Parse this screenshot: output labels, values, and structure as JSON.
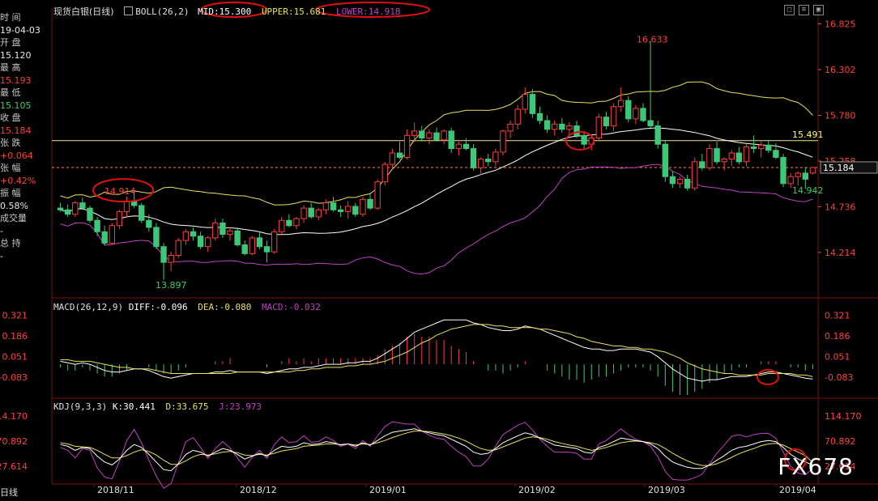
{
  "header": {
    "instrument": "现货白银",
    "period": "(日线)",
    "boll_label": "BOLL(26,2)",
    "mid": "MID:15.300",
    "upper": "UPPER:15.681",
    "lower": "LOWER:14.918"
  },
  "sidebar": [
    {
      "label": "时 间",
      "value": "19-04-03",
      "color": "normal"
    },
    {
      "label": "开 盘",
      "value": "15.120",
      "color": "normal"
    },
    {
      "label": "最 高",
      "value": "15.193",
      "color": "red"
    },
    {
      "label": "最 低",
      "value": "15.105",
      "color": "green"
    },
    {
      "label": "收 盘",
      "value": "15.184",
      "color": "red"
    },
    {
      "label": "张 跌",
      "value": "+0.064",
      "color": "red"
    },
    {
      "label": "张 幅",
      "value": "+0.42%",
      "color": "red"
    },
    {
      "label": "振 幅",
      "value": "0.58%",
      "color": "normal"
    },
    {
      "label": "成交量",
      "value": "-",
      "color": "normal"
    },
    {
      "label": "总 持",
      "value": "-",
      "color": "normal"
    }
  ],
  "macd_header": {
    "label": "MACD(26,12,9)",
    "diff": "DIFF:-0.096",
    "dea": "DEA:-0.080",
    "macd": "MACD:-0.032"
  },
  "kdj_header": {
    "label": "KDJ(9,3,3)",
    "k": "K:30.441",
    "d": "D:33.675",
    "j": "J:23.973"
  },
  "bottom_tab": "日线",
  "watermark": "FX678",
  "colors": {
    "up": "#ff3c3c",
    "down": "#3cc878",
    "mid": "#ffffff",
    "upper": "#e8e060",
    "lower": "#c040c0",
    "hline": "#f0e68c",
    "dashed": "#ff8c3c"
  },
  "chart_data": [
    {
      "type": "candlestick",
      "title": "现货白银(日线)",
      "x_tick_labels": [
        "2018/11",
        "2018/12",
        "2019/01",
        "2019/02",
        "2019/03",
        "2019/04"
      ],
      "y_ticks": [
        16.825,
        16.302,
        15.78,
        15.258,
        14.736,
        14.214
      ],
      "ylim": [
        13.75,
        16.95
      ],
      "horizontal_line": 15.491,
      "current_price": 15.184,
      "annotations": [
        {
          "text": "16.633",
          "value": 16.633
        },
        {
          "text": "15.491",
          "value": 15.491
        },
        {
          "text": "14.914",
          "value": 14.914
        },
        {
          "text": "14.942",
          "value": 14.942
        },
        {
          "text": "13.897",
          "value": 13.897
        }
      ],
      "candles": [
        [
          14.72,
          14.78,
          14.68,
          14.7
        ],
        [
          14.7,
          14.76,
          14.62,
          14.65
        ],
        [
          14.65,
          14.8,
          14.62,
          14.78
        ],
        [
          14.78,
          14.84,
          14.7,
          14.72
        ],
        [
          14.72,
          14.75,
          14.55,
          14.58
        ],
        [
          14.58,
          14.62,
          14.4,
          14.45
        ],
        [
          14.45,
          14.52,
          14.3,
          14.32
        ],
        [
          14.32,
          14.55,
          14.3,
          14.52
        ],
        [
          14.52,
          14.7,
          14.48,
          14.68
        ],
        [
          14.68,
          14.85,
          14.62,
          14.8
        ],
        [
          14.8,
          14.9,
          14.72,
          14.75
        ],
        [
          14.75,
          14.78,
          14.55,
          14.58
        ],
        [
          14.58,
          14.65,
          14.45,
          14.5
        ],
        [
          14.5,
          14.55,
          14.25,
          14.28
        ],
        [
          14.28,
          14.32,
          13.9,
          14.1
        ],
        [
          14.1,
          14.22,
          14.0,
          14.18
        ],
        [
          14.18,
          14.38,
          14.15,
          14.35
        ],
        [
          14.35,
          14.48,
          14.3,
          14.45
        ],
        [
          14.45,
          14.5,
          14.35,
          14.4
        ],
        [
          14.4,
          14.45,
          14.25,
          14.28
        ],
        [
          14.28,
          14.4,
          14.22,
          14.38
        ],
        [
          14.38,
          14.6,
          14.35,
          14.55
        ],
        [
          14.55,
          14.6,
          14.38,
          14.42
        ],
        [
          14.42,
          14.5,
          14.35,
          14.46
        ],
        [
          14.46,
          14.5,
          14.28,
          14.3
        ],
        [
          14.3,
          14.35,
          14.18,
          14.2
        ],
        [
          14.2,
          14.4,
          14.18,
          14.38
        ],
        [
          14.38,
          14.45,
          14.25,
          14.28
        ],
        [
          14.28,
          14.35,
          14.1,
          14.22
        ],
        [
          14.22,
          14.48,
          14.2,
          14.45
        ],
        [
          14.45,
          14.62,
          14.42,
          14.58
        ],
        [
          14.58,
          14.65,
          14.5,
          14.52
        ],
        [
          14.52,
          14.62,
          14.48,
          14.6
        ],
        [
          14.6,
          14.75,
          14.55,
          14.72
        ],
        [
          14.72,
          14.78,
          14.6,
          14.62
        ],
        [
          14.62,
          14.72,
          14.58,
          14.7
        ],
        [
          14.7,
          14.82,
          14.65,
          14.78
        ],
        [
          14.78,
          14.85,
          14.68,
          14.7
        ],
        [
          14.7,
          14.75,
          14.62,
          14.68
        ],
        [
          14.68,
          14.8,
          14.6,
          14.74
        ],
        [
          14.74,
          14.78,
          14.62,
          14.65
        ],
        [
          14.65,
          14.85,
          14.62,
          14.82
        ],
        [
          14.82,
          14.88,
          14.7,
          14.72
        ],
        [
          14.72,
          15.05,
          14.7,
          15.02
        ],
        [
          15.02,
          15.25,
          14.98,
          15.22
        ],
        [
          15.22,
          15.4,
          15.18,
          15.35
        ],
        [
          15.35,
          15.48,
          15.28,
          15.3
        ],
        [
          15.3,
          15.62,
          15.28,
          15.55
        ],
        [
          15.55,
          15.7,
          15.48,
          15.6
        ],
        [
          15.6,
          15.66,
          15.48,
          15.52
        ],
        [
          15.52,
          15.62,
          15.45,
          15.58
        ],
        [
          15.58,
          15.64,
          15.48,
          15.5
        ],
        [
          15.5,
          15.62,
          15.45,
          15.6
        ],
        [
          15.6,
          15.64,
          15.35,
          15.4
        ],
        [
          15.4,
          15.48,
          15.32,
          15.45
        ],
        [
          15.45,
          15.52,
          15.38,
          15.4
        ],
        [
          15.4,
          15.45,
          15.15,
          15.18
        ],
        [
          15.18,
          15.3,
          15.1,
          15.28
        ],
        [
          15.28,
          15.34,
          15.2,
          15.25
        ],
        [
          15.25,
          15.4,
          15.2,
          15.36
        ],
        [
          15.36,
          15.62,
          15.32,
          15.6
        ],
        [
          15.6,
          15.72,
          15.52,
          15.68
        ],
        [
          15.68,
          15.9,
          15.62,
          15.85
        ],
        [
          15.85,
          16.1,
          15.8,
          16.02
        ],
        [
          16.02,
          16.08,
          15.75,
          15.8
        ],
        [
          15.8,
          15.88,
          15.68,
          15.72
        ],
        [
          15.72,
          15.78,
          15.58,
          15.62
        ],
        [
          15.62,
          15.72,
          15.55,
          15.68
        ],
        [
          15.68,
          15.75,
          15.58,
          15.62
        ],
        [
          15.62,
          15.7,
          15.55,
          15.66
        ],
        [
          15.66,
          15.72,
          15.52,
          15.55
        ],
        [
          15.55,
          15.6,
          15.4,
          15.45
        ],
        [
          15.45,
          15.55,
          15.38,
          15.52
        ],
        [
          15.52,
          15.8,
          15.48,
          15.76
        ],
        [
          15.76,
          15.82,
          15.62,
          15.66
        ],
        [
          15.66,
          15.92,
          15.6,
          15.88
        ],
        [
          15.88,
          16.1,
          15.82,
          15.95
        ],
        [
          15.95,
          16.0,
          15.7,
          15.74
        ],
        [
          15.74,
          15.9,
          15.68,
          15.86
        ],
        [
          15.86,
          15.92,
          15.7,
          15.72
        ],
        [
          15.72,
          16.63,
          15.62,
          15.66
        ],
        [
          15.66,
          15.72,
          15.4,
          15.45
        ],
        [
          15.45,
          15.5,
          15.02,
          15.08
        ],
        [
          15.08,
          15.14,
          14.95,
          15.0
        ],
        [
          15.0,
          15.08,
          14.95,
          15.05
        ],
        [
          15.05,
          15.1,
          14.92,
          14.95
        ],
        [
          14.95,
          15.3,
          14.92,
          15.25
        ],
        [
          15.25,
          15.34,
          15.15,
          15.18
        ],
        [
          15.18,
          15.45,
          15.15,
          15.4
        ],
        [
          15.4,
          15.48,
          15.22,
          15.25
        ],
        [
          15.25,
          15.3,
          15.15,
          15.28
        ],
        [
          15.28,
          15.38,
          15.2,
          15.35
        ],
        [
          15.35,
          15.42,
          15.22,
          15.25
        ],
        [
          15.25,
          15.45,
          15.2,
          15.42
        ],
        [
          15.42,
          15.55,
          15.35,
          15.4
        ],
        [
          15.4,
          15.48,
          15.3,
          15.44
        ],
        [
          15.44,
          15.5,
          15.35,
          15.38
        ],
        [
          15.38,
          15.46,
          15.28,
          15.3
        ],
        [
          15.3,
          15.34,
          14.96,
          15.0
        ],
        [
          15.0,
          15.12,
          14.95,
          15.08
        ],
        [
          15.08,
          15.14,
          14.98,
          15.12
        ],
        [
          15.12,
          15.19,
          14.94,
          15.05
        ],
        [
          15.12,
          15.193,
          15.105,
          15.184
        ]
      ]
    },
    {
      "type": "macd",
      "title": "MACD(26,12,9)",
      "y_ticks": [
        0.321,
        0.186,
        0.051,
        -0.083
      ],
      "ylim": [
        -0.2,
        0.36
      ],
      "diff": [
        0.02,
        0.01,
        0.0,
        0.01,
        0.0,
        -0.02,
        -0.04,
        -0.05,
        -0.05,
        -0.04,
        -0.03,
        -0.03,
        -0.04,
        -0.06,
        -0.08,
        -0.09,
        -0.08,
        -0.07,
        -0.06,
        -0.06,
        -0.06,
        -0.05,
        -0.05,
        -0.04,
        -0.05,
        -0.05,
        -0.05,
        -0.05,
        -0.06,
        -0.05,
        -0.04,
        -0.03,
        -0.03,
        -0.02,
        -0.02,
        -0.01,
        0.0,
        0.0,
        0.0,
        0.01,
        0.01,
        0.02,
        0.02,
        0.04,
        0.07,
        0.1,
        0.13,
        0.17,
        0.21,
        0.23,
        0.25,
        0.27,
        0.29,
        0.29,
        0.29,
        0.29,
        0.27,
        0.26,
        0.24,
        0.23,
        0.22,
        0.22,
        0.23,
        0.25,
        0.24,
        0.23,
        0.21,
        0.19,
        0.17,
        0.15,
        0.13,
        0.11,
        0.1,
        0.1,
        0.09,
        0.09,
        0.1,
        0.1,
        0.1,
        0.09,
        0.08,
        0.05,
        0.01,
        -0.03,
        -0.06,
        -0.09,
        -0.1,
        -0.11,
        -0.1,
        -0.1,
        -0.09,
        -0.08,
        -0.08,
        -0.08,
        -0.07,
        -0.06,
        -0.05,
        -0.05,
        -0.06,
        -0.07,
        -0.08,
        -0.09,
        -0.096
      ],
      "dea": [
        0.03,
        0.03,
        0.02,
        0.02,
        0.02,
        0.01,
        0.0,
        -0.01,
        -0.02,
        -0.02,
        -0.03,
        -0.03,
        -0.03,
        -0.04,
        -0.05,
        -0.06,
        -0.06,
        -0.06,
        -0.06,
        -0.06,
        -0.06,
        -0.06,
        -0.06,
        -0.06,
        -0.05,
        -0.05,
        -0.05,
        -0.05,
        -0.05,
        -0.05,
        -0.05,
        -0.05,
        -0.04,
        -0.04,
        -0.03,
        -0.03,
        -0.02,
        -0.02,
        -0.02,
        -0.01,
        -0.01,
        0.0,
        0.0,
        0.01,
        0.02,
        0.04,
        0.06,
        0.08,
        0.11,
        0.14,
        0.16,
        0.19,
        0.21,
        0.23,
        0.24,
        0.25,
        0.26,
        0.26,
        0.26,
        0.25,
        0.25,
        0.24,
        0.24,
        0.24,
        0.24,
        0.23,
        0.23,
        0.22,
        0.21,
        0.2,
        0.18,
        0.17,
        0.15,
        0.14,
        0.13,
        0.12,
        0.12,
        0.11,
        0.11,
        0.1,
        0.1,
        0.09,
        0.08,
        0.06,
        0.04,
        0.01,
        -0.01,
        -0.03,
        -0.04,
        -0.05,
        -0.06,
        -0.06,
        -0.07,
        -0.07,
        -0.07,
        -0.07,
        -0.06,
        -0.06,
        -0.06,
        -0.06,
        -0.07,
        -0.07,
        -0.08
      ]
    },
    {
      "type": "kdj",
      "title": "KDJ(9,3,3)",
      "y_ticks": [
        114.17,
        70.892,
        27.614
      ],
      "ylim": [
        0,
        125
      ],
      "k": [
        65,
        62,
        55,
        60,
        58,
        45,
        35,
        30,
        40,
        55,
        65,
        60,
        48,
        35,
        22,
        20,
        32,
        48,
        55,
        52,
        45,
        52,
        58,
        55,
        48,
        40,
        45,
        50,
        45,
        55,
        62,
        60,
        62,
        68,
        65,
        66,
        70,
        68,
        64,
        66,
        62,
        68,
        64,
        72,
        80,
        86,
        88,
        90,
        92,
        88,
        85,
        82,
        80,
        74,
        68,
        62,
        52,
        48,
        50,
        58,
        68,
        74,
        80,
        85,
        82,
        76,
        70,
        64,
        62,
        60,
        58,
        52,
        50,
        60,
        64,
        70,
        76,
        74,
        72,
        70,
        66,
        58,
        45,
        35,
        30,
        26,
        24,
        24,
        30,
        38,
        46,
        55,
        60,
        62,
        66,
        70,
        72,
        70,
        60,
        48,
        40,
        35,
        30
      ],
      "d": [
        68,
        66,
        62,
        61,
        60,
        55,
        48,
        42,
        42,
        46,
        52,
        56,
        53,
        47,
        38,
        31,
        31,
        37,
        44,
        48,
        47,
        49,
        52,
        53,
        51,
        47,
        46,
        48,
        47,
        50,
        54,
        56,
        58,
        62,
        63,
        64,
        66,
        66,
        65,
        66,
        64,
        66,
        65,
        68,
        72,
        77,
        81,
        85,
        88,
        88,
        87,
        85,
        83,
        80,
        76,
        71,
        64,
        58,
        55,
        56,
        61,
        66,
        71,
        76,
        78,
        77,
        74,
        70,
        67,
        64,
        62,
        58,
        55,
        57,
        60,
        64,
        68,
        70,
        71,
        70,
        68,
        65,
        58,
        50,
        43,
        37,
        32,
        29,
        29,
        32,
        37,
        43,
        49,
        54,
        58,
        63,
        66,
        67,
        64,
        58,
        52,
        46,
        34
      ],
      "j": [
        60,
        55,
        42,
        58,
        55,
        25,
        9,
        6,
        36,
        72,
        91,
        68,
        38,
        11,
        -10,
        -2,
        34,
        70,
        77,
        60,
        41,
        58,
        70,
        59,
        42,
        26,
        43,
        55,
        41,
        65,
        78,
        68,
        70,
        80,
        69,
        70,
        78,
        72,
        62,
        66,
        58,
        72,
        62,
        80,
        96,
        104,
        102,
        100,
        100,
        88,
        81,
        76,
        74,
        62,
        52,
        44,
        28,
        28,
        40,
        62,
        82,
        90,
        98,
        103,
        90,
        74,
        62,
        52,
        52,
        52,
        50,
        40,
        40,
        66,
        72,
        82,
        92,
        82,
        74,
        70,
        62,
        44,
        19,
        5,
        4,
        4,
        8,
        14,
        32,
        50,
        64,
        79,
        82,
        78,
        82,
        84,
        84,
        76,
        52,
        28,
        16,
        13,
        24
      ]
    }
  ]
}
